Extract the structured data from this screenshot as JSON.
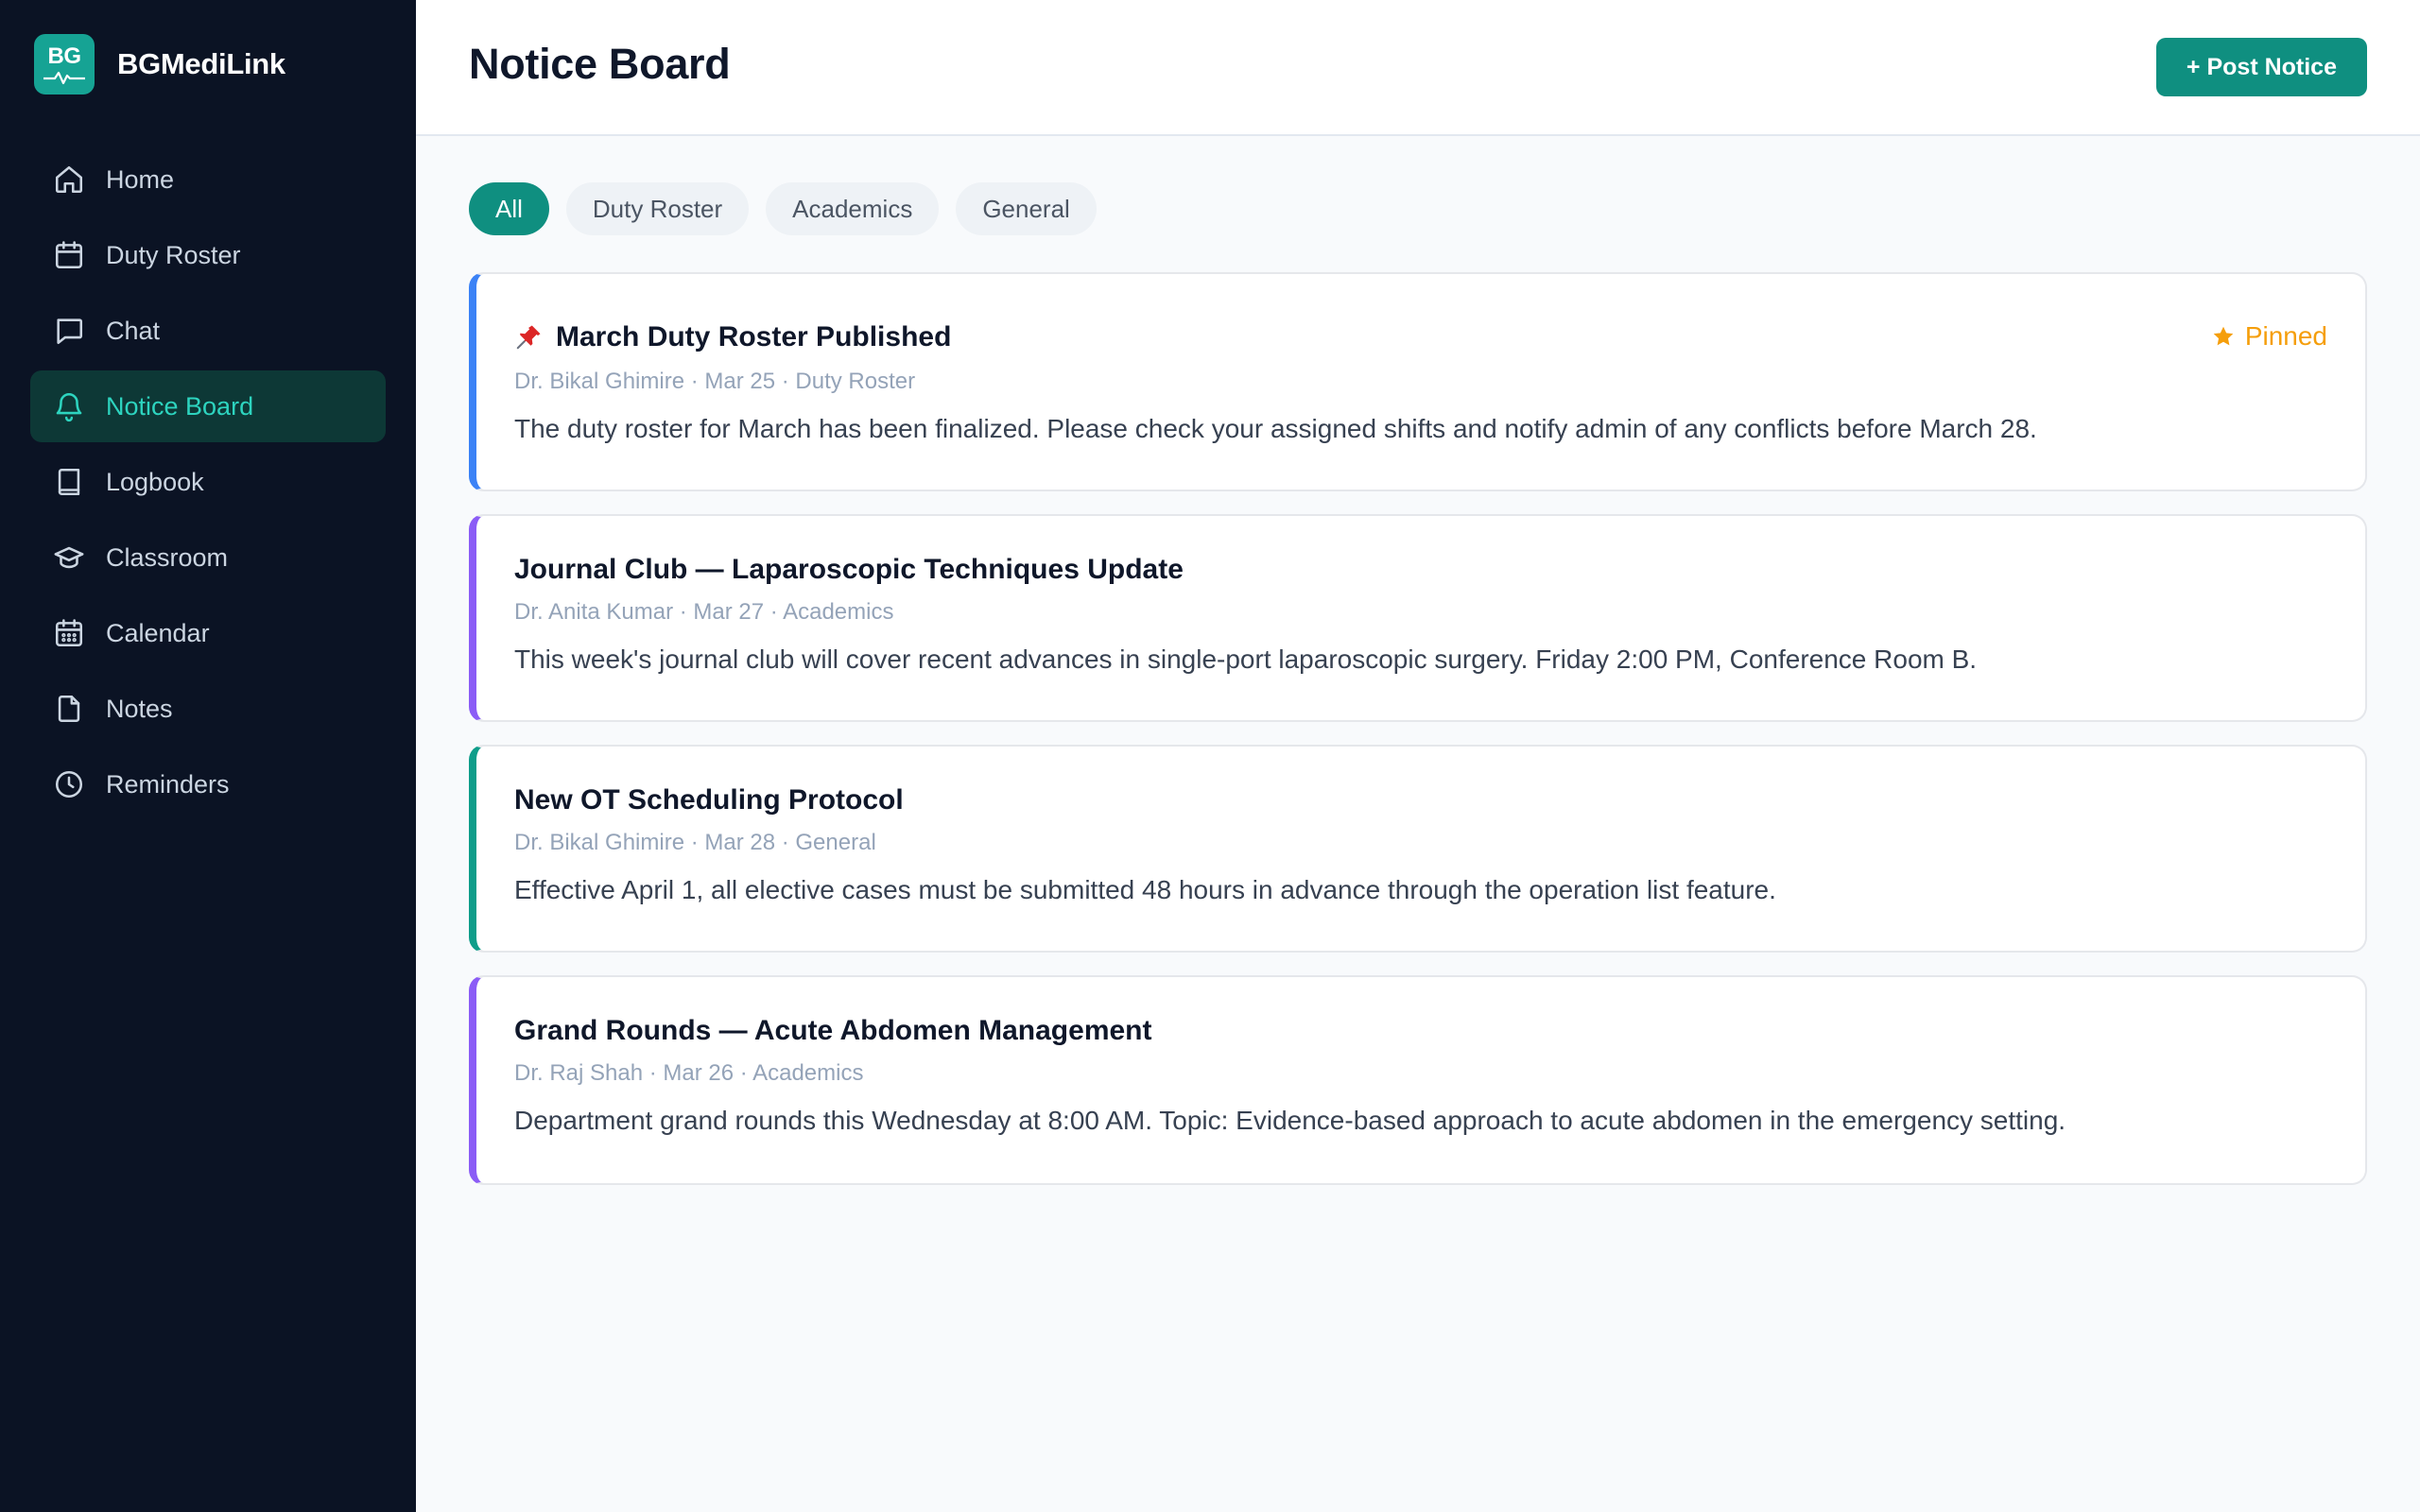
{
  "app": {
    "name": "BGMediLink",
    "logo_text": "BG"
  },
  "sidebar": {
    "items": [
      {
        "label": "Home",
        "icon": "home-icon"
      },
      {
        "label": "Duty Roster",
        "icon": "calendar-icon"
      },
      {
        "label": "Chat",
        "icon": "chat-icon"
      },
      {
        "label": "Notice Board",
        "icon": "bell-icon",
        "active": true
      },
      {
        "label": "Logbook",
        "icon": "book-icon"
      },
      {
        "label": "Classroom",
        "icon": "graduation-cap-icon"
      },
      {
        "label": "Calendar",
        "icon": "calendar-grid-icon"
      },
      {
        "label": "Notes",
        "icon": "file-icon"
      },
      {
        "label": "Reminders",
        "icon": "clock-icon"
      }
    ]
  },
  "header": {
    "title": "Notice Board",
    "post_button": "+ Post Notice"
  },
  "filters": [
    "All",
    "Duty Roster",
    "Academics",
    "General"
  ],
  "active_filter": "All",
  "notices": [
    {
      "title": "March Duty Roster Published",
      "meta": "Dr. Bikal Ghimire · Mar 25 · Duty Roster",
      "body": "The duty roster for March has been finalized. Please check your assigned shifts and notify admin of any conflicts before March 28.",
      "pinned": true,
      "pinned_label": "Pinned",
      "accent": "#3b82f6"
    },
    {
      "title": "Journal Club — Laparoscopic Techniques Update",
      "meta": "Dr. Anita Kumar · Mar 27 · Academics",
      "body": "This week's journal club will cover recent advances in single-port laparoscopic surgery. Friday 2:00 PM, Conference Room B.",
      "accent": "#8b5cf6"
    },
    {
      "title": "New OT Scheduling Protocol",
      "meta": "Dr. Bikal Ghimire · Mar 28 · General",
      "body": "Effective April 1, all elective cases must be submitted 48 hours in advance through the operation list feature.",
      "accent": "#0f9d8a"
    },
    {
      "title": "Grand Rounds — Acute Abdomen Management",
      "meta": "Dr. Raj Shah · Mar 26 · Academics",
      "body": "Department grand rounds this Wednesday at 8:00 AM. Topic: Evidence-based approach to acute abdomen in the emergency setting.",
      "accent": "#8b5cf6"
    }
  ],
  "colors": {
    "sidebar_bg": "#0b1324",
    "brand": "#16a394",
    "primary": "#0f8f80",
    "active_nav_text": "#2dd4bf",
    "pinned": "#f59e0b"
  }
}
